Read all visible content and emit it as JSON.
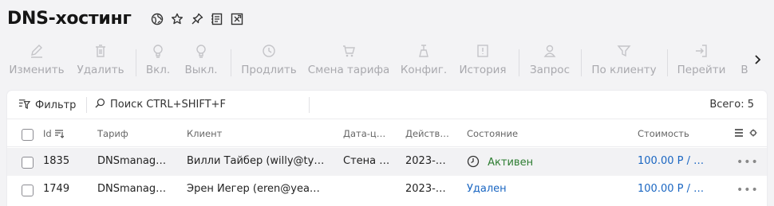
{
  "page": {
    "title": "DNS-хостинг"
  },
  "title_icons": [
    "globe-icon",
    "star-icon",
    "pin-icon",
    "document-icon",
    "export-icon"
  ],
  "toolbar": {
    "buttons": [
      {
        "label": "Изменить",
        "icon": "pencil-icon"
      },
      {
        "label": "Удалить",
        "icon": "trash-icon"
      },
      {
        "label": "Вкл.",
        "icon": "bulb-on-icon"
      },
      {
        "label": "Выкл.",
        "icon": "bulb-off-icon"
      },
      {
        "label": "Продлить",
        "icon": "clock-icon"
      },
      {
        "label": "Смена тарифа",
        "icon": "cart-icon"
      },
      {
        "label": "Конфиг.",
        "icon": "config-icon"
      },
      {
        "label": "История",
        "icon": "history-icon"
      },
      {
        "label": "Запрос",
        "icon": "request-icon"
      },
      {
        "label": "По клиенту",
        "icon": "funnel-icon"
      },
      {
        "label": "Перейти",
        "icon": "goto-icon"
      },
      {
        "label": "В",
        "icon": "more-icon"
      }
    ],
    "disabled_color": "#b6b6bb"
  },
  "filterbar": {
    "filter_label": "Фильтр",
    "search_placeholder": "Поиск CTRL+SHIFT+F",
    "total": "Всего: 5"
  },
  "table": {
    "columns": [
      "Id",
      "Тариф",
      "Клиент",
      "Дата-ц…",
      "Действ…",
      "Состояние",
      "Стоимость"
    ],
    "rows": [
      {
        "id": "1835",
        "tariff": "DNSmanag…",
        "client": "Вилли Тайбер (willy@ty…",
        "date": "Стена …",
        "valid": "2023-…",
        "status": "Активен",
        "cost": "100.00 Р / …"
      },
      {
        "id": "1749",
        "tariff": "DNSmanag…",
        "client": "Эрен Йегер (eren@yeag…",
        "date": "",
        "valid": "2023-…",
        "status": "Удален",
        "cost": "100.00 Р / …"
      }
    ]
  },
  "colors": {
    "link": "#1a66c2",
    "active": "#2e7d32",
    "background": "#f3f3f5"
  }
}
